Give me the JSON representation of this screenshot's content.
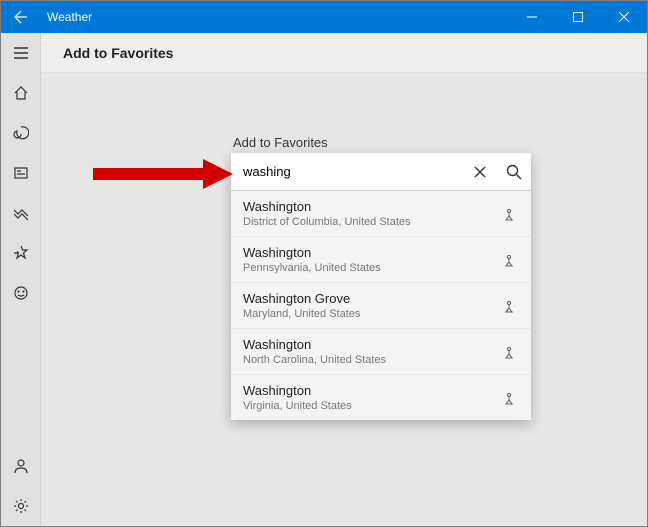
{
  "titlebar": {
    "app_name": "Weather"
  },
  "header": {
    "title": "Add to Favorites"
  },
  "panel": {
    "title": "Add to Favorites",
    "search_value": "washing",
    "results": [
      {
        "name": "Washington",
        "sub": "District of Columbia, United States"
      },
      {
        "name": "Washington",
        "sub": "Pennsylvania, United States"
      },
      {
        "name": "Washington Grove",
        "sub": "Maryland, United States"
      },
      {
        "name": "Washington",
        "sub": "North Carolina, United States"
      },
      {
        "name": "Washington",
        "sub": "Virginia, United States"
      }
    ]
  }
}
